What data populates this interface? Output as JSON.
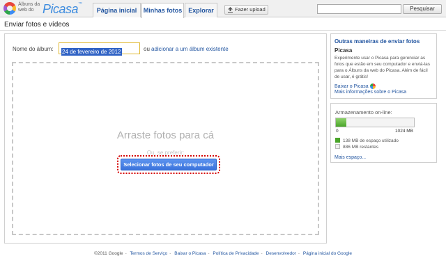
{
  "header": {
    "logo_line1": "Álbuns da",
    "logo_line2": "web do",
    "logo_brand": "Picasa",
    "logo_suffix": "™",
    "tabs": [
      {
        "label": "Página inicial",
        "active": false
      },
      {
        "label": "Minhas fotos",
        "active": true
      },
      {
        "label": "Explorar",
        "active": false
      }
    ],
    "upload_label": "Fazer upload",
    "search_value": "",
    "search_button": "Pesquisar"
  },
  "page": {
    "title": "Enviar fotos e vídeos"
  },
  "album": {
    "label": "Nome do álbum:",
    "value": "24 de fevereiro de 2012",
    "or_text": "ou",
    "existing_link": "adicionar a um álbum existente"
  },
  "dropzone": {
    "title": "Arraste fotos para cá",
    "or_text": "Ou, se preferir:",
    "select_button": "Selecionar fotos de seu computador"
  },
  "sidebar": {
    "other_ways": {
      "title": "Outras maneiras de enviar fotos",
      "subtitle": "Picasa",
      "description": "Experimente usar o Picasa para gerenciar as fotos que estão em seu computador e enviá-las para o Álbuns da web do Picasa. Além de fácil de usar, é grátis!",
      "download_link": "Baixar o Picasa",
      "more_info_link": "Mais informações sobre o Picasa"
    },
    "storage": {
      "title": "Armazenamento on-line:",
      "min_label": "0",
      "max_label": "1024 MB",
      "used_fraction": 0.135,
      "used_label": "138 MB de espaço utilizado",
      "free_label": "886 MB restantes",
      "more_space_link": "Mais espaço..."
    }
  },
  "footer": {
    "copyright": "©2011 Google",
    "links": [
      "Termos de Serviço",
      "Baixar o Picasa",
      "Política de Privacidade",
      "Desenvolvedor",
      "Página inicial do Google"
    ]
  },
  "colors": {
    "link": "#2255a0",
    "select_button": "#3a73dc",
    "storage_fill": "#4aa52a",
    "highlight_outline": "#d40000"
  }
}
